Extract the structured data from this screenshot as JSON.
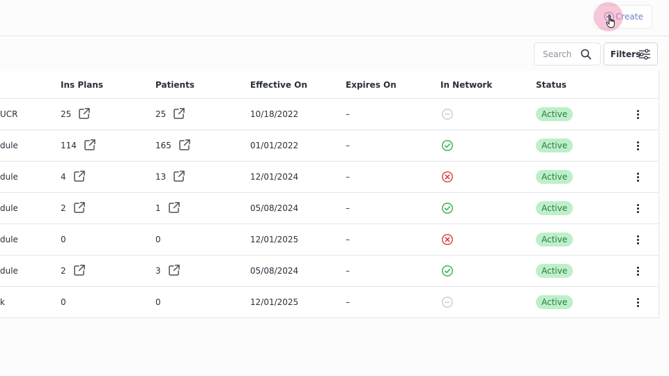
{
  "header": {
    "create_label": "Create"
  },
  "toolbar": {
    "search_placeholder": "Search",
    "filters_label": "Filters"
  },
  "table": {
    "columns": {
      "ins_plans": "Ins Plans",
      "patients": "Patients",
      "effective_on": "Effective On",
      "expires_on": "Expires On",
      "in_network": "In Network",
      "status": "Status"
    },
    "rows": [
      {
        "name": "UCR",
        "ins_plans": "25",
        "patients": "25",
        "effective_on": "10/18/2022",
        "expires_on": "–",
        "in_network": "neutral",
        "status": "Active",
        "ins_link": true,
        "pat_link": true
      },
      {
        "name": "dule",
        "ins_plans": "114",
        "patients": "165",
        "effective_on": "01/01/2022",
        "expires_on": "–",
        "in_network": "yes",
        "status": "Active",
        "ins_link": true,
        "pat_link": true
      },
      {
        "name": "dule",
        "ins_plans": "4",
        "patients": "13",
        "effective_on": "12/01/2024",
        "expires_on": "–",
        "in_network": "no",
        "status": "Active",
        "ins_link": true,
        "pat_link": true
      },
      {
        "name": "dule",
        "ins_plans": "2",
        "patients": "1",
        "effective_on": "05/08/2024",
        "expires_on": "–",
        "in_network": "yes",
        "status": "Active",
        "ins_link": true,
        "pat_link": true
      },
      {
        "name": "dule",
        "ins_plans": "0",
        "patients": "0",
        "effective_on": "12/01/2025",
        "expires_on": "–",
        "in_network": "no",
        "status": "Active",
        "ins_link": false,
        "pat_link": false
      },
      {
        "name": "dule",
        "ins_plans": "2",
        "patients": "3",
        "effective_on": "05/08/2024",
        "expires_on": "–",
        "in_network": "yes",
        "status": "Active",
        "ins_link": true,
        "pat_link": true
      },
      {
        "name": "k",
        "ins_plans": "0",
        "patients": "0",
        "effective_on": "12/01/2025",
        "expires_on": "–",
        "in_network": "neutral",
        "status": "Active",
        "ins_link": false,
        "pat_link": false
      }
    ]
  },
  "colors": {
    "accent": "#6a86c9",
    "status_bg": "#bdf0c9",
    "network_yes": "#2fae4a",
    "network_no": "#d83a3a",
    "network_neutral": "#c4c7cc"
  }
}
